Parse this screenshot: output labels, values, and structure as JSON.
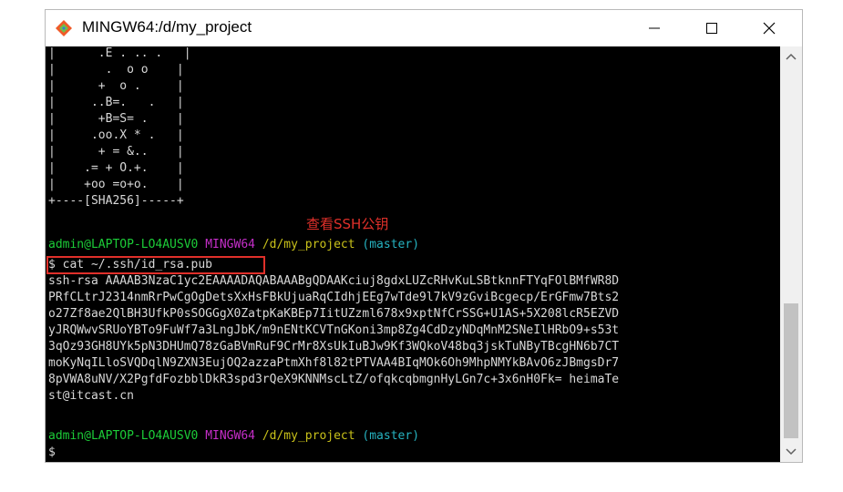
{
  "window": {
    "title": "MINGW64:/d/my_project"
  },
  "terminal": {
    "art": [
      "|      .E . .. .   |",
      "|       .  o o    |",
      "|      +  o .     |",
      "|     ..B=.   .   |",
      "|      +B=S= .    |",
      "|     .oo.X * .   |",
      "|      + = &..    |",
      "|    .= + O.+.    |",
      "|    +oo =o+o.    |",
      "+----[SHA256]-----+"
    ],
    "annotation": "查看SSH公钥",
    "prompt1": {
      "user": "admin@LAPTOP-LO4AUSV0",
      "env": "MINGW64",
      "path": "/d/my_project",
      "branch": "(master)"
    },
    "command": "$ cat ~/.ssh/id_rsa.pub",
    "key_lines": [
      "ssh-rsa AAAAB3NzaC1yc2EAAAADAQABAAABgQDAAKciuj8gdxLUZcRHvKuLSBtknnFTYqFOlBMfWR8D",
      "PRfCLtrJ2314nmRrPwCgOgDetsXxHsFBkUjuaRqCIdhjEEg7wTde9l7kV9zGviBcgecp/ErGFmw7Bts2",
      "o27Zf8ae2QlBH3UfkP0sSOGGgX0ZatpKaKBEp7IitUZzml678x9xptNfCrSSG+U1AS+5X208lcR5EZVD",
      "yJRQWwvSRUoYBTo9FuWf7a3LngJbK/m9nENtKCVTnGKoni3mp8Zg4CdDzyNDqMnM2SNeIlHRbO9+s53t",
      "3qOz93GH8UYk5pN3DHUmQ78zGaBVmRuF9CrMr8XsUkIuBJw9Kf3WQkoV48bq3jskTuNByTBcgHN6b7CT",
      "moKyNqILloSVQDqlN9ZXN3EujOQ2azzaPtmXhf8l82tPTVAA4BIqMOk6Oh9MhpNMYkBAvO6zJBmgsDr7",
      "8pVWA8uNV/X2PgfdFozbblDkR3spd3rQeX9KNNMscLtZ/ofqkcqbmgnHyLGn7c+3x6nH0Fk= heimaTe",
      "st@itcast.cn"
    ],
    "prompt2": {
      "user": "admin@LAPTOP-LO4AUSV0",
      "env": "MINGW64",
      "path": "/d/my_project",
      "branch": "(master)"
    },
    "cursor_prompt": "$"
  },
  "colors": {
    "terminal_bg": "#000000",
    "text": "#d8d8d8",
    "user": "#1ccc38",
    "env": "#c42ec8",
    "path": "#c9c21a",
    "branch": "#26b3c1",
    "annotation": "#e0302a"
  },
  "icons": {
    "app": "git-bash-icon",
    "minimize": "minimize-icon",
    "maximize": "maximize-icon",
    "close": "close-icon"
  }
}
